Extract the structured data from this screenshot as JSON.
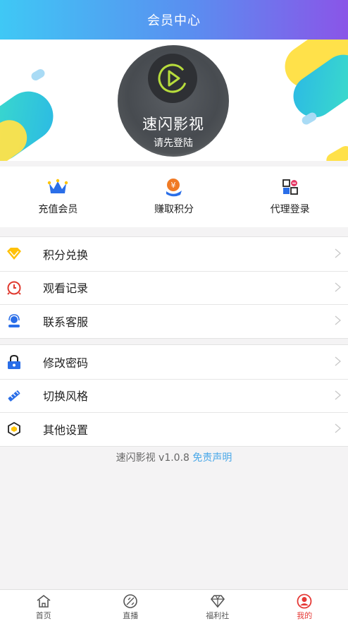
{
  "header": {
    "title": "会员中心"
  },
  "profile": {
    "app_name": "速闪影视",
    "login_hint": "请先登陆"
  },
  "quick_actions": [
    {
      "label": "充值会员",
      "icon": "crown-icon"
    },
    {
      "label": "赚取积分",
      "icon": "coin-icon"
    },
    {
      "label": "代理登录",
      "icon": "agent-icon"
    }
  ],
  "menu_group_1": [
    {
      "label": "积分兑换",
      "icon": "diamond-icon"
    },
    {
      "label": "观看记录",
      "icon": "clock-icon"
    },
    {
      "label": "联系客服",
      "icon": "headset-icon"
    }
  ],
  "menu_group_2": [
    {
      "label": "修改密码",
      "icon": "lock-icon"
    },
    {
      "label": "切换风格",
      "icon": "brush-icon"
    },
    {
      "label": "其他设置",
      "icon": "hexagon-settings-icon"
    }
  ],
  "footer": {
    "version_text": "速闪影视 v1.0.8",
    "disclaimer_link": "免责声明"
  },
  "tabbar": [
    {
      "label": "首页",
      "icon": "home-icon"
    },
    {
      "label": "直播",
      "icon": "live-icon"
    },
    {
      "label": "福利社",
      "icon": "gem-icon"
    },
    {
      "label": "我的",
      "icon": "user-icon",
      "active": true
    }
  ],
  "colors": {
    "accent": "#e53935",
    "link": "#4aa8e8",
    "header_start": "#3fc8f5",
    "header_end": "#8a55e8"
  }
}
